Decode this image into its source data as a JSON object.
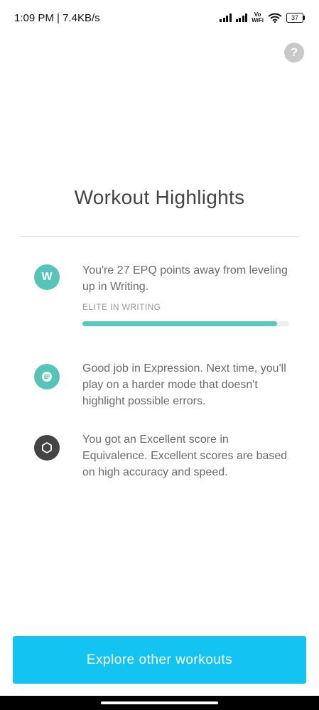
{
  "status_bar": {
    "time_speed": "1:09 PM | 7.4KB/s",
    "vowifi_top": "Vo",
    "vowifi_bottom": "WiFi",
    "battery": "37"
  },
  "help_icon_label": "?",
  "title": "Workout Highlights",
  "highlights": [
    {
      "icon": "W",
      "text": "You're 27 EPQ points away from leveling up in Writing.",
      "subtitle": "ELITE IN WRITING",
      "progress": 0.94
    },
    {
      "icon": "text-lines-icon",
      "text": "Good job in Expression. Next time, you'll play on a harder mode that doesn't highlight possible errors."
    },
    {
      "icon": "hexagon-icon",
      "text": "You got an Excellent score in Equivalence. Excellent scores are based on high accuracy and speed."
    }
  ],
  "explore_button": "Explore other workouts",
  "colors": {
    "accent_teal": "#57c4ba",
    "button_blue": "#13c4f2",
    "dark_icon": "#444444"
  }
}
